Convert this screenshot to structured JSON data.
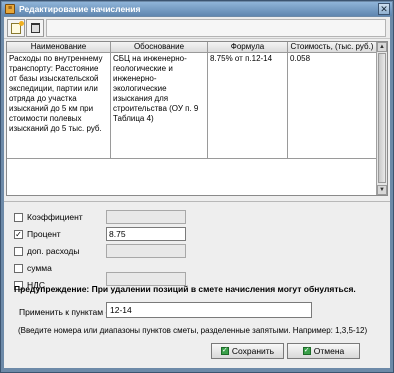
{
  "window": {
    "title": "Редактирование начисления",
    "close_glyph": "✕"
  },
  "table": {
    "columns": [
      "Наименование",
      "Обоснование",
      "Формула",
      "Стоимость, (тыс. руб.)"
    ],
    "rows": [
      {
        "name": "Расходы по внутреннему транспорту: Расстояние от базы изыскательской экспедиции, партии или отряда до участка изысканий до 5 км при стоимости полевых изысканий до 5 тыс. руб.",
        "basis": "СБЦ на инженерно-геологические и инженерно-экологические изыскания для строительства (ОУ п. 9 Таблица 4)",
        "formula": "8.75% от п.12-14",
        "cost": "0.058"
      }
    ]
  },
  "options": [
    {
      "label": "Коэффициент",
      "checked": "",
      "value": ""
    },
    {
      "label": "Процент",
      "checked": "✓",
      "value": "8.75"
    },
    {
      "label": "доп. расходы",
      "checked": "",
      "value": ""
    },
    {
      "label": "сумма",
      "checked": "",
      "value": ""
    },
    {
      "label": "НДС",
      "checked": "",
      "value": ""
    }
  ],
  "warning": "Предупреждение: При удалении позиций в смете начисления могут обнуляться.",
  "apply": {
    "label": "Применить к пунктам сметы",
    "value": "12-14"
  },
  "hint": "(Введите номера или диапазоны пунктов сметы, разделенные запятыми. Например: 1,3,5-12)",
  "buttons": {
    "save": "Сохранить",
    "cancel": "Отмена"
  }
}
